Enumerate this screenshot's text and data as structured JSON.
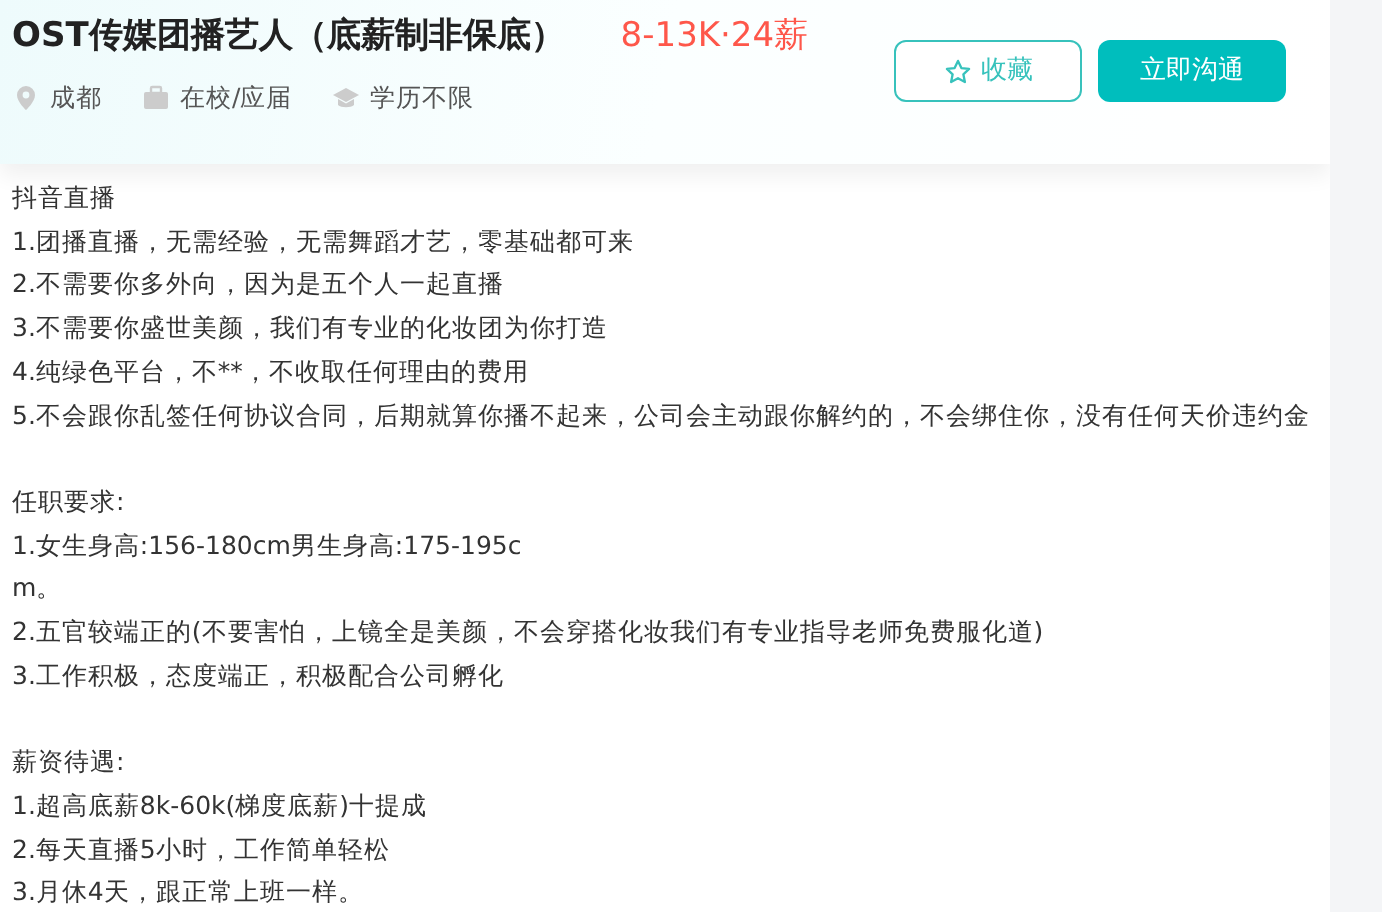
{
  "job": {
    "title": "OST传媒团播艺人（底薪制非保底）",
    "salary": "8-13K·24薪",
    "tags": [
      {
        "kind": "location",
        "text": "成都"
      },
      {
        "kind": "experience",
        "text": "在校/应届"
      },
      {
        "kind": "education",
        "text": "学历不限"
      }
    ],
    "buttons": [
      {
        "kind": "favorite",
        "label": "收藏"
      },
      {
        "kind": "chat",
        "label": "立即沟通"
      }
    ]
  },
  "description": [
    [
      "抖音直播",
      "1.团播直播，无需经验，无需舞蹈才艺，零基础都可来",
      "2.不需要你多外向，因为是五个人一起直播",
      "3.不需要你盛世美颜，我们有专业的化妆团为你打造",
      "4.纯绿色平台，不**，不收取任何理由的费用",
      "5.不会跟你乱签任何协议合同，后期就算你播不起来，公司会主动跟你解约的，不会绑住你，没有任何天价违约金"
    ],
    [
      "任职要求:",
      "1.女生身高:156-180cm男生身高:175-195c",
      "m。",
      "2.五官较端正的(不要害怕，上镜全是美颜，不会穿搭化妆我们有专业指导老师免费服化道)",
      "3.工作积极，态度端正，积极配合公司孵化"
    ],
    [
      "薪资待遇:",
      "1.超高底薪8k-60k(梯度底薪)十提成",
      "2.每天直播5小时，工作简单轻松",
      "3.月休4天，跟正常上班一样。"
    ]
  ]
}
